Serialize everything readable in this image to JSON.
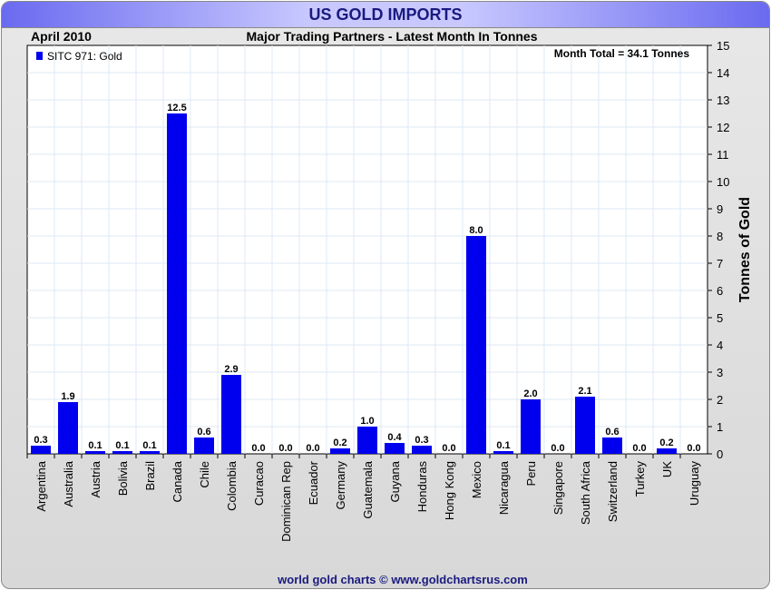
{
  "title": "US GOLD IMPORTS",
  "footer": "world gold charts © www.goldchartsrus.com",
  "chart_data": {
    "type": "bar",
    "title": "Major Trading Partners - Latest Month In Tonnes",
    "date_label": "April 2010",
    "annotation": "Month Total = 34.1 Tonnes",
    "legend": [
      "SITC 971: Gold"
    ],
    "legend_position": "top-left",
    "ylabel": "Tonnes of Gold",
    "xlabel": "",
    "ylim": [
      0,
      15
    ],
    "yticks": [
      0,
      1,
      2,
      3,
      4,
      5,
      6,
      7,
      8,
      9,
      10,
      11,
      12,
      13,
      14,
      15
    ],
    "grid": true,
    "bar_color": "#0000ee",
    "categories": [
      "Argentina",
      "Australia",
      "Austria",
      "Bolivia",
      "Brazil",
      "Canada",
      "Chile",
      "Colombia",
      "Curacao",
      "Dominican Rep",
      "Ecuador",
      "Germany",
      "Guatemala",
      "Guyana",
      "Honduras",
      "Hong Kong",
      "Mexico",
      "Nicaragua",
      "Peru",
      "Singapore",
      "South Africa",
      "Switzerland",
      "Turkey",
      "UK",
      "Uruguay"
    ],
    "values": [
      0.3,
      1.9,
      0.1,
      0.1,
      0.1,
      12.5,
      0.6,
      2.9,
      0.0,
      0.0,
      0.0,
      0.2,
      1.0,
      0.4,
      0.3,
      0.0,
      8.0,
      0.1,
      2.0,
      0.0,
      2.1,
      0.6,
      0.0,
      0.2,
      0.0
    ]
  }
}
